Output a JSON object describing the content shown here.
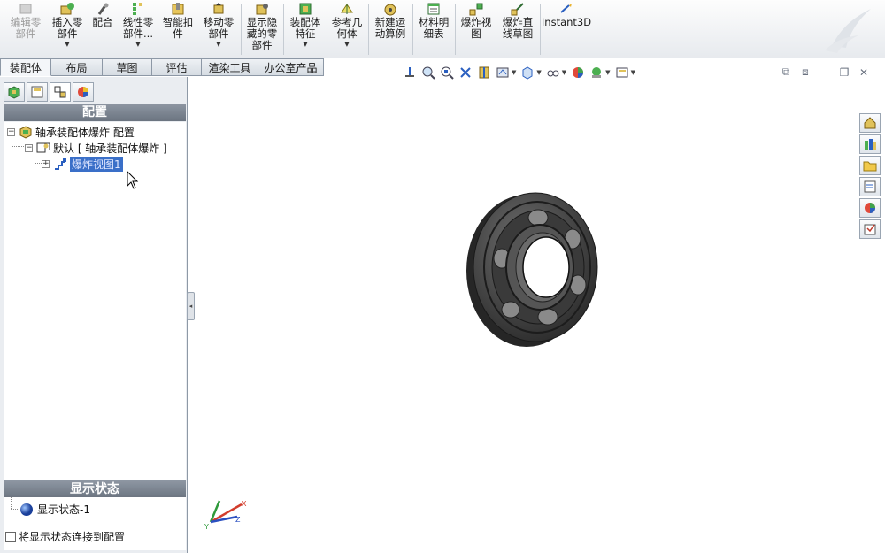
{
  "ribbon": {
    "buttons": [
      {
        "label": "编辑零部件",
        "icon": "edit-component-icon",
        "disabled": true
      },
      {
        "label": "插入零部件",
        "icon": "insert-components-icon"
      },
      {
        "label": "配合",
        "icon": "mate-icon"
      },
      {
        "label": "线性零部件...",
        "icon": "linear-pattern-icon"
      },
      {
        "label": "智能扣件",
        "icon": "smart-fasteners-icon"
      },
      {
        "label": "移动零部件",
        "icon": "move-component-icon"
      },
      {
        "label": "显示隐藏的零部件",
        "icon": "show-hidden-icon"
      },
      {
        "label": "装配体特征",
        "icon": "assembly-features-icon"
      },
      {
        "label": "参考几何体",
        "icon": "reference-geometry-icon"
      },
      {
        "label": "新建运动算例",
        "icon": "motion-study-icon"
      },
      {
        "label": "材料明细表",
        "icon": "bom-icon"
      },
      {
        "label": "爆炸视图",
        "icon": "exploded-view-icon"
      },
      {
        "label": "爆炸直线草图",
        "icon": "explode-line-sketch-icon"
      },
      {
        "label": "Instant3D",
        "icon": "instant3d-icon"
      }
    ]
  },
  "tabs": [
    {
      "label": "装配体",
      "active": true
    },
    {
      "label": "布局"
    },
    {
      "label": "草图"
    },
    {
      "label": "评估"
    },
    {
      "label": "渲染工具"
    },
    {
      "label": "办公室产品"
    }
  ],
  "panel": {
    "config_header": "配置",
    "tree": {
      "root": "轴承装配体爆炸 配置",
      "default_config": "默认 [ 轴承装配体爆炸 ]",
      "explode_view": "爆炸视图1"
    },
    "display_header": "显示状态",
    "display_state": "显示状态-1",
    "link_checkbox": "将显示状态连接到配置"
  },
  "triad": {
    "x": "X",
    "y": "Y",
    "z": "Z"
  },
  "colors": {
    "highlight": "#3a6fc8",
    "header": "#7a838f"
  }
}
